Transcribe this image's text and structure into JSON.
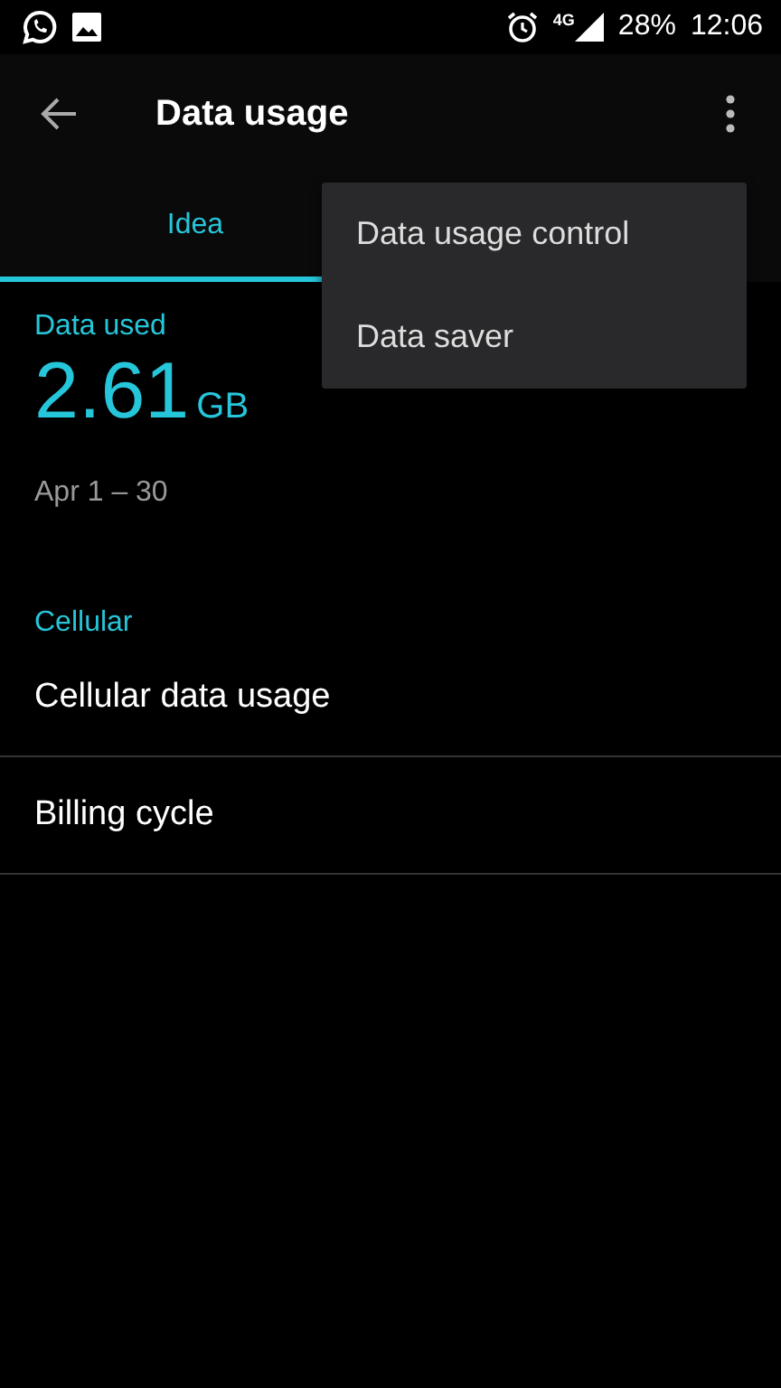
{
  "status_bar": {
    "network": "4G",
    "battery": "28%",
    "time": "12:06"
  },
  "toolbar": {
    "title": "Data usage"
  },
  "tabs": [
    {
      "label": "Idea",
      "selected": true
    }
  ],
  "summary": {
    "label": "Data used",
    "amount": "2.61",
    "unit": "GB",
    "period": "Apr 1 – 30"
  },
  "section": {
    "title": "Cellular",
    "items": [
      "Cellular data usage",
      "Billing cycle"
    ]
  },
  "menu": {
    "items": [
      "Data usage control",
      "Data saver"
    ]
  }
}
